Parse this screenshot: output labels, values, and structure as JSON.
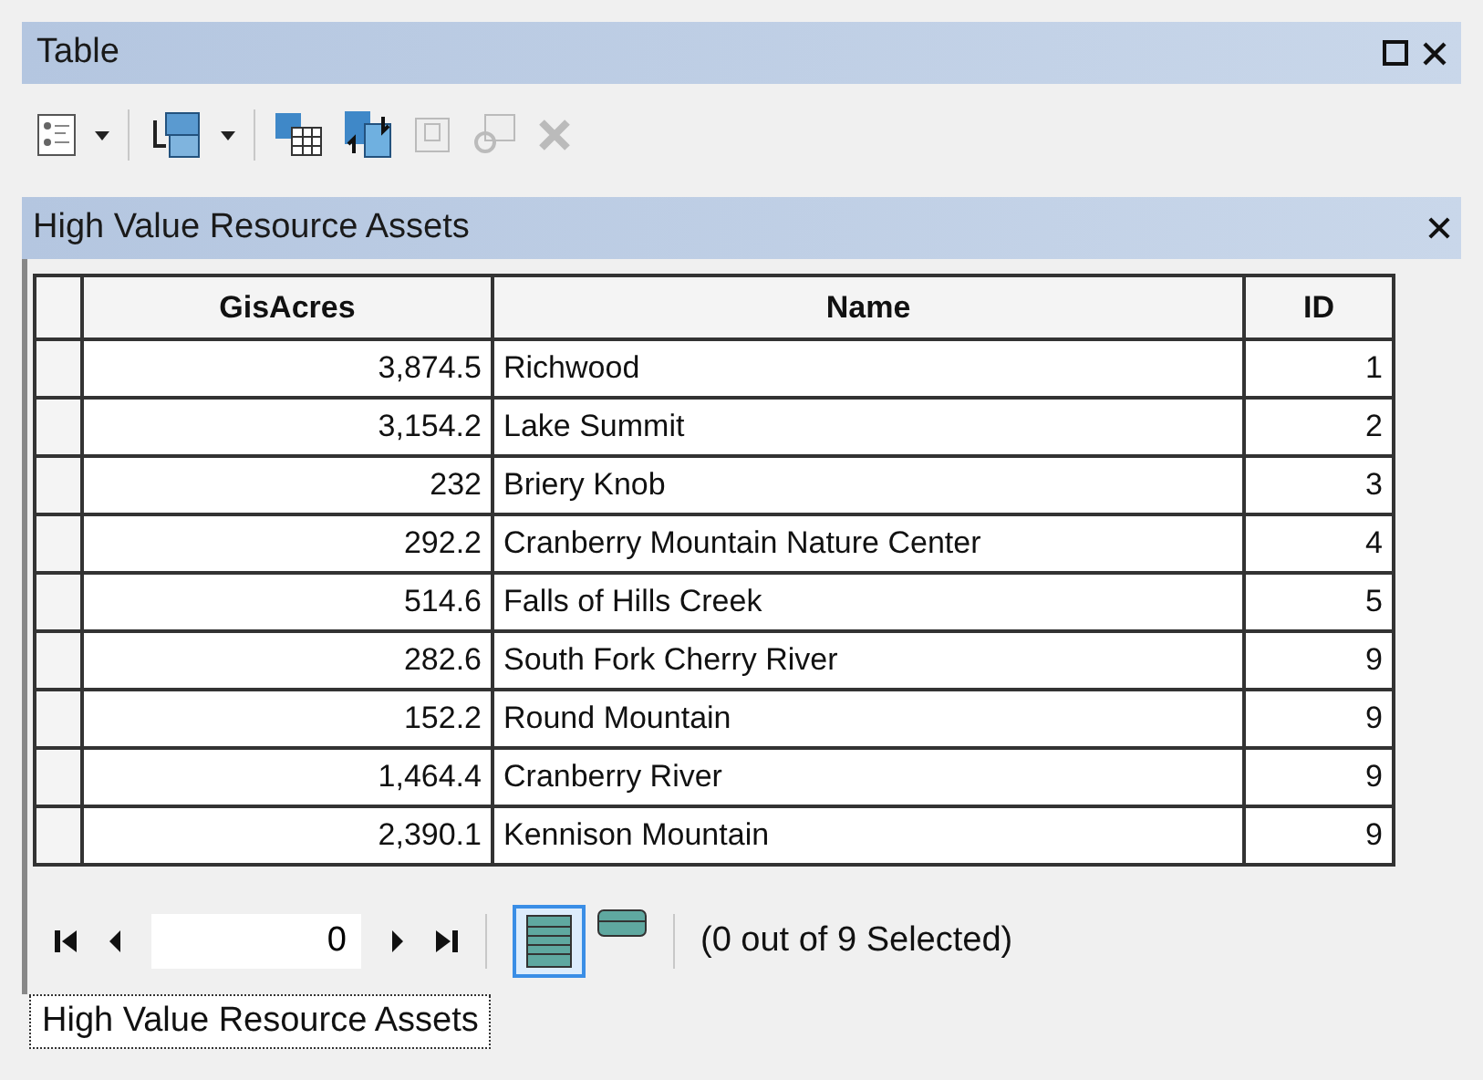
{
  "window": {
    "title": "Table"
  },
  "panel": {
    "title": "High Value Resource Assets"
  },
  "table": {
    "columns": [
      "GisAcres",
      "Name",
      "ID"
    ],
    "rows": [
      {
        "cells": [
          "3,874.5",
          "Richwood",
          "1"
        ],
        "selected": false
      },
      {
        "cells": [
          "3,154.2",
          "Lake Summit",
          "2"
        ],
        "selected": false
      },
      {
        "cells": [
          "232",
          "Briery Knob",
          "3"
        ],
        "selected": false
      },
      {
        "cells": [
          "292.2",
          "Cranberry Mountain Nature Center",
          "4"
        ],
        "selected": false
      },
      {
        "cells": [
          "514.6",
          "Falls of Hills Creek",
          "5"
        ],
        "selected": false
      },
      {
        "cells": [
          "282.6",
          "South Fork Cherry River",
          "9"
        ],
        "selected": false
      },
      {
        "cells": [
          "152.2",
          "Round Mountain",
          "9"
        ],
        "selected": false
      },
      {
        "cells": [
          "1,464.4",
          "Cranberry River",
          "9"
        ],
        "selected": false
      },
      {
        "cells": [
          "2,390.1",
          "Kennison Mountain",
          "9"
        ],
        "selected": false
      }
    ]
  },
  "navigator": {
    "record": "0",
    "status": "(0 out of 9 Selected)",
    "views": [
      {
        "kind": "all",
        "selected": true
      },
      {
        "kind": "selected",
        "selected": false
      }
    ]
  },
  "tabs": [
    {
      "label": "High Value Resource Assets",
      "selected": true
    }
  ]
}
